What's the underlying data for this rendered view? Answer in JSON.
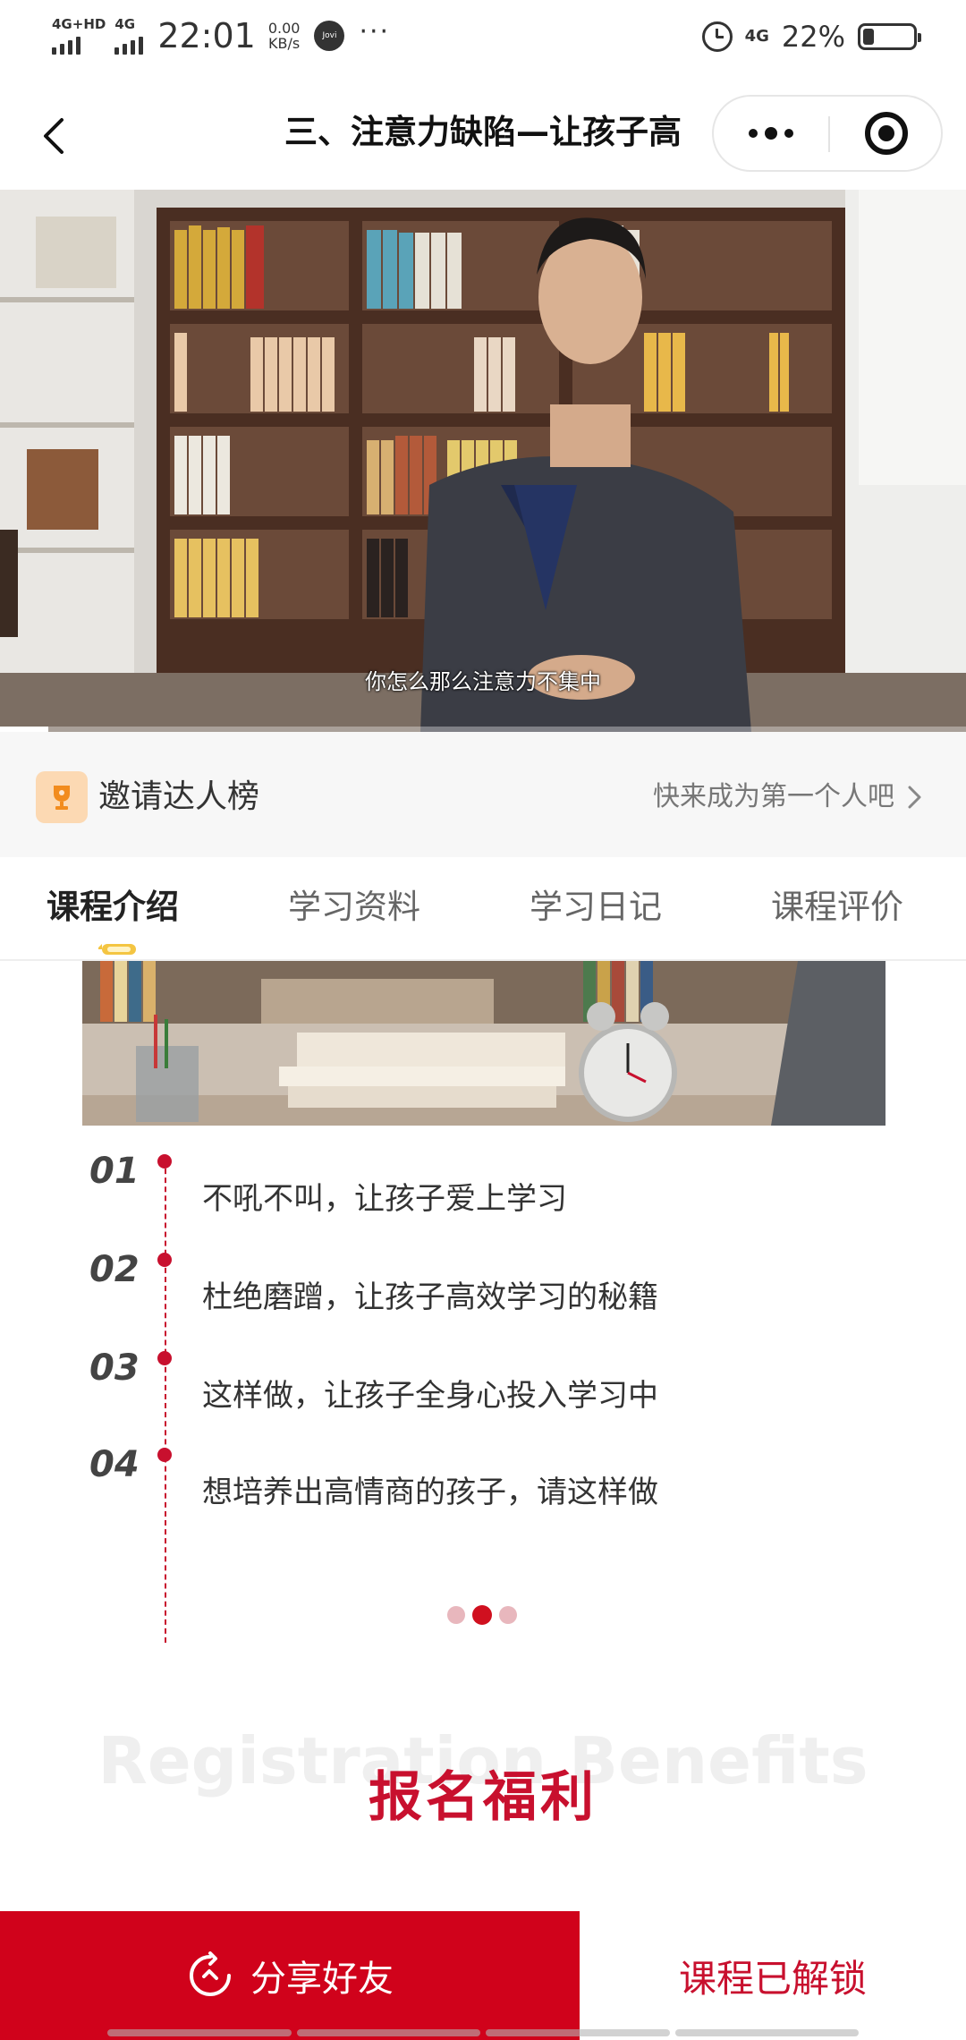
{
  "status_bar": {
    "sim1": "4G+HD",
    "sim2": "4G",
    "time": "22:01",
    "speed_value": "0.00",
    "speed_unit": "KB/s",
    "jovi": "Jovi",
    "more": "···",
    "network": "4G",
    "battery_percent": "22%",
    "battery_level": 0.22
  },
  "nav": {
    "title": "三、注意力缺陷—让孩子高"
  },
  "video": {
    "subtitle": "你怎么那么注意力不集中",
    "progress": 0.05
  },
  "invite": {
    "title": "邀请达人榜",
    "cta": "快来成为第一个人吧"
  },
  "tabs": [
    {
      "label": "课程介绍",
      "active": true
    },
    {
      "label": "学习资料",
      "active": false
    },
    {
      "label": "学习日记",
      "active": false
    },
    {
      "label": "课程评价",
      "active": false
    }
  ],
  "toc": [
    {
      "num": "01",
      "text": "不吼不叫，让孩子爱上学习"
    },
    {
      "num": "02",
      "text": "杜绝磨蹭，让孩子高效学习的秘籍"
    },
    {
      "num": "03",
      "text": "这样做，让孩子全身心投入学习中"
    },
    {
      "num": "04",
      "text": "想培养出高情商的孩子，请这样做"
    }
  ],
  "pager": {
    "count": 3,
    "active": 1
  },
  "benefits": {
    "bg_title": "Registration Benefits",
    "title": "报名福利"
  },
  "bottom": {
    "share_label": "分享好友",
    "unlock_label": "课程已解锁"
  },
  "colors": {
    "accent_red": "#c8102e",
    "share_red": "#d0021b"
  },
  "icons": {
    "back": "chevron-left-icon",
    "more": "more-dots-icon",
    "close": "target-close-icon",
    "trophy": "trophy-icon",
    "arrow": "chevron-right-icon",
    "share": "refresh-share-icon",
    "pencil": "pencil-icon"
  }
}
